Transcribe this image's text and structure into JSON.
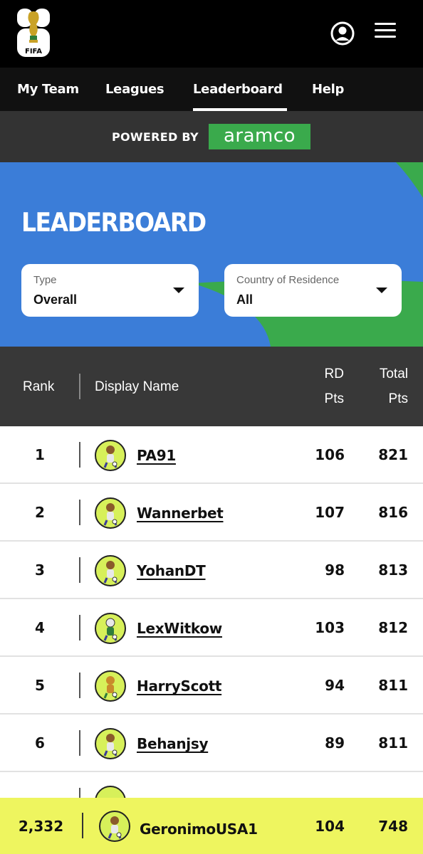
{
  "header": {
    "logo_number_text": "26",
    "logo_text": "FIFA",
    "user_icon": "user-circle-icon",
    "menu_icon": "hamburger-menu-icon"
  },
  "nav": {
    "items": [
      {
        "label": "My Team"
      },
      {
        "label": "Leagues"
      },
      {
        "label": "Leaderboard",
        "active": true
      },
      {
        "label": "Help"
      }
    ]
  },
  "sponsor": {
    "powered_by": "POWERED BY",
    "brand": "aramco"
  },
  "hero": {
    "title": "LEADERBOARD",
    "filters": [
      {
        "label": "Type",
        "value": "Overall"
      },
      {
        "label": "Country of Residence",
        "value": "All"
      }
    ]
  },
  "table": {
    "headers": {
      "rank": "Rank",
      "display_name": "Display Name",
      "rd_line1": "RD",
      "rd_line2": "Pts",
      "total_line1": "Total",
      "total_line2": "Pts"
    },
    "rows": [
      {
        "rank": "1",
        "name": "PA91",
        "rd": "106",
        "total": "821"
      },
      {
        "rank": "2",
        "name": "Wannerbet",
        "rd": "107",
        "total": "816"
      },
      {
        "rank": "3",
        "name": "YohanDT",
        "rd": "98",
        "total": "813"
      },
      {
        "rank": "4",
        "name": "LexWitkow",
        "rd": "103",
        "total": "812"
      },
      {
        "rank": "5",
        "name": "HarryScott",
        "rd": "94",
        "total": "811"
      },
      {
        "rank": "6",
        "name": "Behanjsy",
        "rd": "89",
        "total": "811"
      }
    ]
  },
  "me": {
    "rank": "2,332",
    "name": "GeronimoUSA1",
    "rd": "104",
    "total": "748"
  },
  "colors": {
    "hero_blue": "#3b7dd8",
    "accent_green": "#3aaa4c",
    "highlight_yellow": "#eef55f",
    "avatar_lime": "#d7f05a"
  }
}
